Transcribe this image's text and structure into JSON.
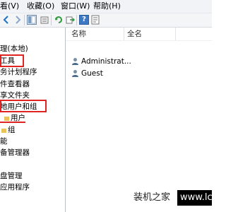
{
  "menu": {
    "items": [
      "看(V)",
      "收藏(O)",
      "窗口(W)",
      "帮助(H)"
    ],
    "partial_left": "看(V)"
  },
  "toolbar": {
    "buttons": [
      "back-icon",
      "forward-icon",
      "up-icon",
      "show-tree-icon",
      "refresh-icon",
      "export-icon",
      "help-icon",
      "properties-icon"
    ]
  },
  "tree": {
    "items": [
      {
        "label": "理(本地)",
        "icon": "computer-icon"
      },
      {
        "label": "工具",
        "icon": "tools-icon"
      },
      {
        "label": "务计划程序",
        "icon": "task-icon"
      },
      {
        "label": "件查看器",
        "icon": "event-icon"
      },
      {
        "label": "享文件夹",
        "icon": "folder-icon"
      },
      {
        "label": "地用户和组",
        "icon": "users-icon"
      },
      {
        "label": "用户",
        "icon": "folder-icon"
      },
      {
        "label": "组",
        "icon": "folder-icon"
      },
      {
        "label": "能",
        "icon": "perf-icon"
      },
      {
        "label": "备管理器",
        "icon": "device-icon"
      },
      {
        "label": "",
        "icon": "storage-icon"
      },
      {
        "label": "盘管理",
        "icon": "disk-icon"
      },
      {
        "label": "应用程序",
        "icon": "app-icon"
      }
    ]
  },
  "list": {
    "columns": [
      "名称",
      "全名"
    ],
    "rows": [
      {
        "name": "Administrat...",
        "fullname": ""
      },
      {
        "name": "Guest",
        "fullname": ""
      }
    ]
  },
  "watermark": {
    "text": "装机之家",
    "url_fragment": "www.lc"
  },
  "colors": {
    "highlight": "#e02424",
    "menubar": "#f1f3f6",
    "toolbar": "#f4f5f7"
  }
}
